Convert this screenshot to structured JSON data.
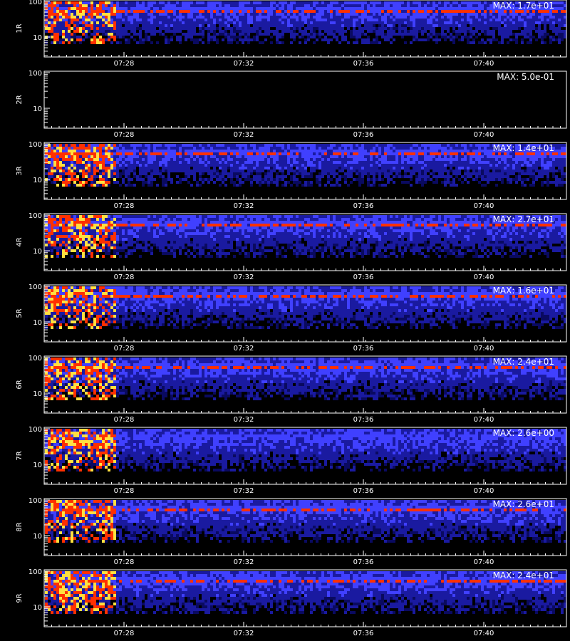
{
  "chart_data": {
    "type": "heatmap",
    "xlabel": "",
    "x_ticks": [
      "07:28",
      "07:32",
      "07:36",
      "07:40"
    ],
    "y_ticks": [
      "10",
      "100"
    ],
    "y_scale": "log",
    "panels": [
      {
        "label": "1R",
        "max_text": "MAX: 1.7e+01",
        "max": 17
      },
      {
        "label": "2R",
        "max_text": "MAX: 5.0e-01",
        "max": 0.5
      },
      {
        "label": "3R",
        "max_text": "MAX: 1.4e+01",
        "max": 14
      },
      {
        "label": "4R",
        "max_text": "MAX: 2.7e+01",
        "max": 27
      },
      {
        "label": "5R",
        "max_text": "MAX: 1.6e+01",
        "max": 16
      },
      {
        "label": "6R",
        "max_text": "MAX: 2.4e+01",
        "max": 24
      },
      {
        "label": "7R",
        "max_text": "MAX: 2.6e+00",
        "max": 2.6
      },
      {
        "label": "8R",
        "max_text": "MAX: 2.6e+01",
        "max": 26
      },
      {
        "label": "9R",
        "max_text": "MAX: 2.4e+01",
        "max": 24
      }
    ],
    "colors": {
      "low": "#1a1aa0",
      "mid": "#4040ff",
      "high": "#ff3000",
      "peak": "#ffe040"
    }
  }
}
